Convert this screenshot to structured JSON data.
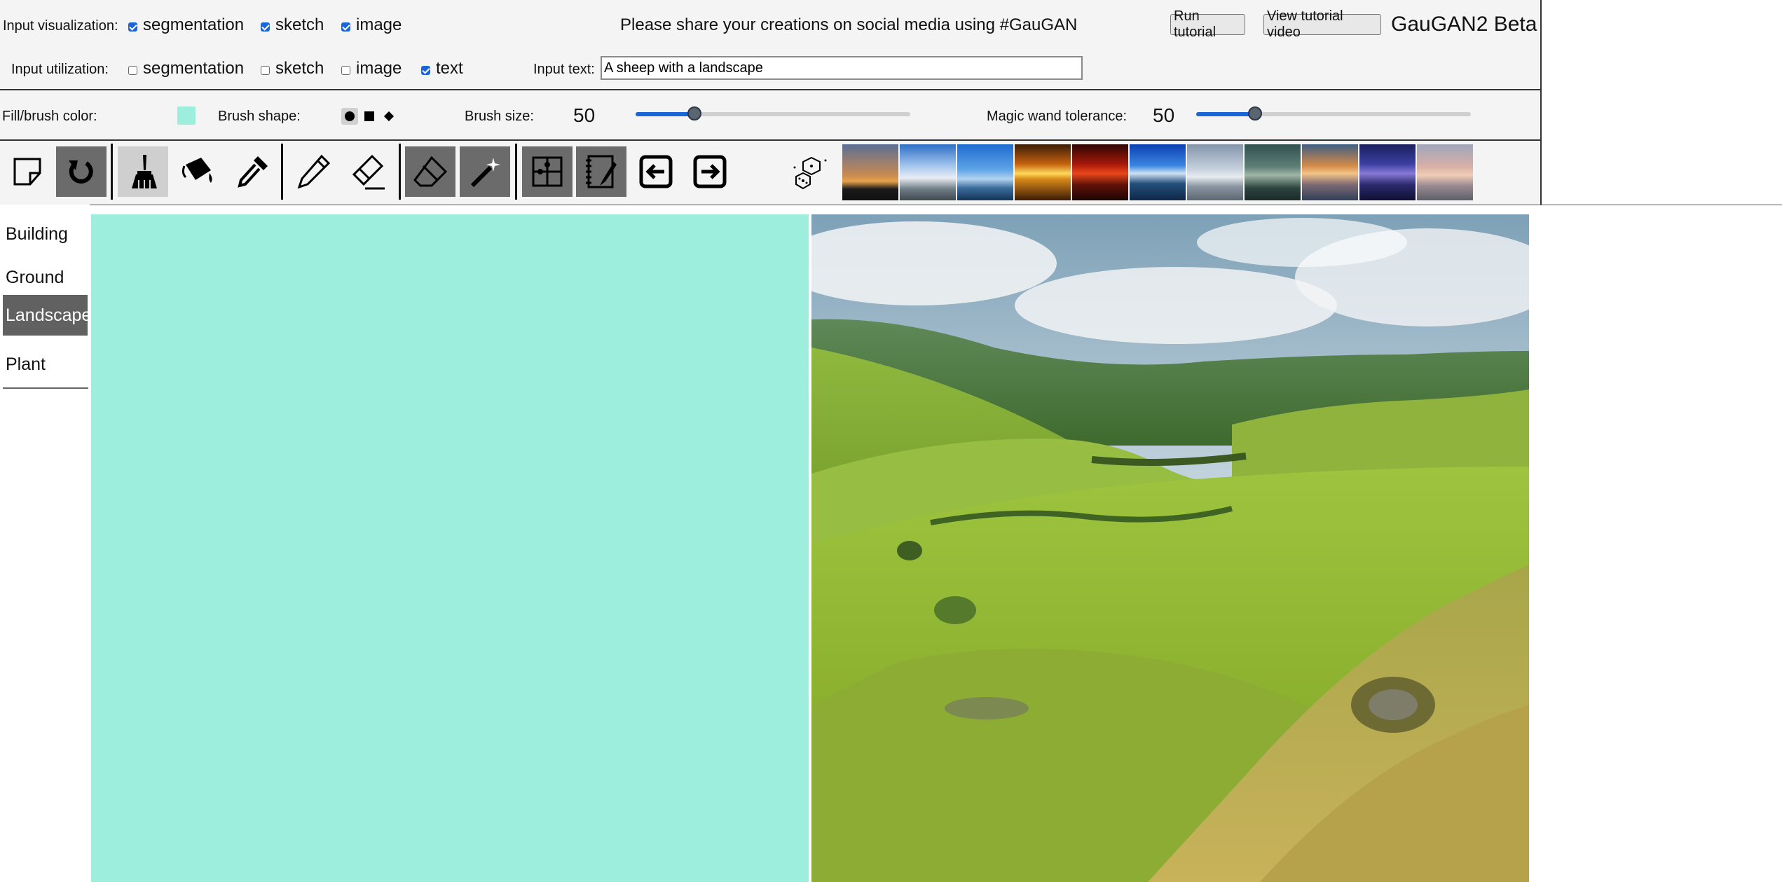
{
  "header": {
    "brand": "GauGAN2 Beta",
    "share_message": "Please share your creations on social media using #GauGAN",
    "run_tutorial": "Run tutorial",
    "view_tutorial_video": "View tutorial video"
  },
  "input_visualization": {
    "label": "Input visualization:",
    "options": [
      {
        "label": "segmentation",
        "checked": true
      },
      {
        "label": "sketch",
        "checked": true
      },
      {
        "label": "image",
        "checked": true
      }
    ]
  },
  "input_utilization": {
    "label": "Input utilization:",
    "options": [
      {
        "label": "segmentation",
        "checked": false
      },
      {
        "label": "sketch",
        "checked": false
      },
      {
        "label": "image",
        "checked": false
      },
      {
        "label": "text",
        "checked": true
      }
    ]
  },
  "input_text": {
    "label": "Input text:",
    "value": "A sheep with a landscape"
  },
  "brush": {
    "fill_label": "Fill/brush color:",
    "fill_color": "#9deedc",
    "shape_label": "Brush shape:",
    "shapes": [
      "circle",
      "square",
      "diamond"
    ],
    "selected_shape": "circle",
    "size_label": "Brush size:",
    "size_value": "50",
    "size_fraction": 0.2
  },
  "magic_wand": {
    "label": "Magic wand tolerance:",
    "value": "50",
    "fraction": 0.2
  },
  "tools": [
    {
      "name": "new-canvas-icon"
    },
    {
      "name": "undo-icon"
    },
    {
      "name": "brush-icon"
    },
    {
      "name": "paint-bucket-icon"
    },
    {
      "name": "eyedropper-icon"
    },
    {
      "name": "pencil-icon"
    },
    {
      "name": "pencil-eraser-icon"
    },
    {
      "name": "eraser-icon"
    },
    {
      "name": "magic-wand-icon"
    },
    {
      "name": "segmentation-map-icon"
    },
    {
      "name": "sketch-notebook-icon"
    },
    {
      "name": "arrow-left-icon"
    },
    {
      "name": "arrow-right-icon"
    },
    {
      "name": "random-dice-icon"
    }
  ],
  "style_thumbnails": [
    {
      "name": "style-sunset-trees"
    },
    {
      "name": "style-blue-sky-road"
    },
    {
      "name": "style-blue-sea-horizon"
    },
    {
      "name": "style-golden-sunset-sea"
    },
    {
      "name": "style-red-sunset"
    },
    {
      "name": "style-mountain-lake"
    },
    {
      "name": "style-grey-seascape"
    },
    {
      "name": "style-dark-teal-shore"
    },
    {
      "name": "style-orange-clouds-lake"
    },
    {
      "name": "style-purple-dusk"
    },
    {
      "name": "style-pastel-sunset-beach"
    }
  ],
  "labels": {
    "items": [
      {
        "label": "Building",
        "selected": false
      },
      {
        "label": "Ground",
        "selected": false
      },
      {
        "label": "Landscape",
        "selected": true
      },
      {
        "label": "Plant",
        "selected": false
      }
    ]
  },
  "colors": {
    "accent": "#1a66d6",
    "selected_category": "#616161",
    "canvas_fill": "#9deedc"
  }
}
